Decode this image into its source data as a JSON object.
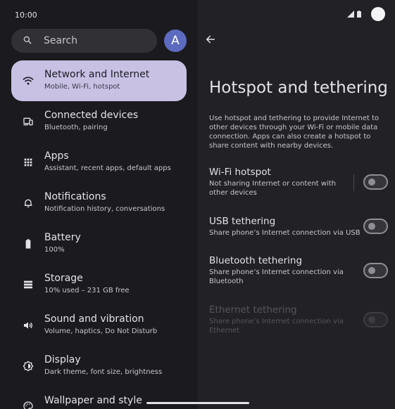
{
  "status_bar": {
    "time": "10:00"
  },
  "search": {
    "placeholder": "Search"
  },
  "account": {
    "avatar_letter": "A"
  },
  "sidebar": {
    "items": [
      {
        "title": "Network and Internet",
        "subtitle": "Mobile, Wi-Fi, hotspot",
        "icon": "wifi-icon",
        "selected": true
      },
      {
        "title": "Connected devices",
        "subtitle": "Bluetooth, pairing",
        "icon": "devices-icon"
      },
      {
        "title": "Apps",
        "subtitle": "Assistant, recent apps, default apps",
        "icon": "apps-grid-icon"
      },
      {
        "title": "Notifications",
        "subtitle": "Notification history, conversations",
        "icon": "bell-icon"
      },
      {
        "title": "Battery",
        "subtitle": "100%",
        "icon": "battery-icon"
      },
      {
        "title": "Storage",
        "subtitle": "10% used – 231 GB free",
        "icon": "storage-icon"
      },
      {
        "title": "Sound and vibration",
        "subtitle": "Volume, haptics, Do Not Disturb",
        "icon": "volume-icon"
      },
      {
        "title": "Display",
        "subtitle": "Dark theme, font size, brightness",
        "icon": "brightness-icon"
      },
      {
        "title": "Wallpaper and style",
        "subtitle": "",
        "icon": "palette-icon"
      }
    ]
  },
  "detail": {
    "title": "Hotspot and tethering",
    "description": "Use hotspot and tethering to provide Internet to other devices through your Wi-Fi or mobile data connection. Apps can also create a hotspot to share content with nearby devices.",
    "settings": [
      {
        "title": "Wi-Fi hotspot",
        "subtitle": "Not sharing Internet or content with other devices",
        "enabled": true,
        "on": false
      },
      {
        "title": "USB tethering",
        "subtitle": "Share phone’s Internet connection via USB",
        "enabled": true,
        "on": false
      },
      {
        "title": "Bluetooth tethering",
        "subtitle": "Share phone’s Internet connection via Bluetooth",
        "enabled": true,
        "on": false
      },
      {
        "title": "Ethernet tethering",
        "subtitle": "Share phone’s Internet connection via Ethernet",
        "enabled": false,
        "on": false
      }
    ]
  },
  "colors": {
    "selected_item_bg": "#c8c1e4",
    "avatar_bg": "#5c6bc0",
    "background": "#1b1b1f",
    "detail_background": "#222226"
  }
}
